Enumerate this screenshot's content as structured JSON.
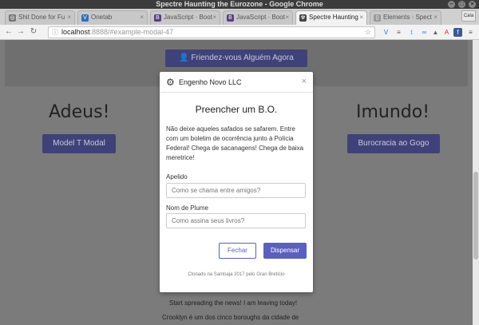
{
  "window": {
    "title": "Spectre Haunting the Eurozone - Google Chrome"
  },
  "tabs": [
    {
      "label": "Shit Done for Fu",
      "icon": "globe-icon"
    },
    {
      "label": "Onetab",
      "icon": "onetab-icon"
    },
    {
      "label": "JavaScript · Boot",
      "icon": "bootstrap-icon"
    },
    {
      "label": "JavaScript · Boot",
      "icon": "bootstrap-icon"
    },
    {
      "label": "Spectre Haunting",
      "icon": "spectre-icon"
    },
    {
      "label": "Elements · Spect",
      "icon": "document-icon"
    }
  ],
  "profile_badge": "Cala",
  "address": {
    "host": "localhost",
    "rest": ":8888/#example-modal-47"
  },
  "extensions": [
    "V",
    "≡",
    "t",
    "∞",
    "▲",
    "A",
    "f",
    "≡"
  ],
  "background": {
    "top_button": "Friendez-vous Alguém Agora",
    "left_heading": "Adeus!",
    "left_button": "Model T Modal",
    "right_heading": "Imundo!",
    "right_button": "Burocracia ao Gogo",
    "line1": "Start spreading the news! I am leaving today!",
    "line2": "Crooklyn é um dos cinco boroughs da cidade de"
  },
  "modal": {
    "brand": "Engenho Novo LLC",
    "close_label": "×",
    "title": "Preencher um B.O.",
    "body": "Não deixe aqueles safados se safarem. Entre com um boletim de ocorrência junto à Polícia Federal! Chega de sacanagens! Chega de baixa meretrice!",
    "field1": {
      "label": "Apelido",
      "placeholder": "Como se chama entre amigos?"
    },
    "field2": {
      "label": "Nom de Plume",
      "placeholder": "Como assina seus livros?"
    },
    "cancel_label": "Fechar",
    "submit_label": "Dispensar",
    "footer": "Clonado na Santoaja 2017 pelo Gran Bretício"
  },
  "colors": {
    "primary": "#5b5fc0",
    "overlay": "#7b7b7b"
  }
}
